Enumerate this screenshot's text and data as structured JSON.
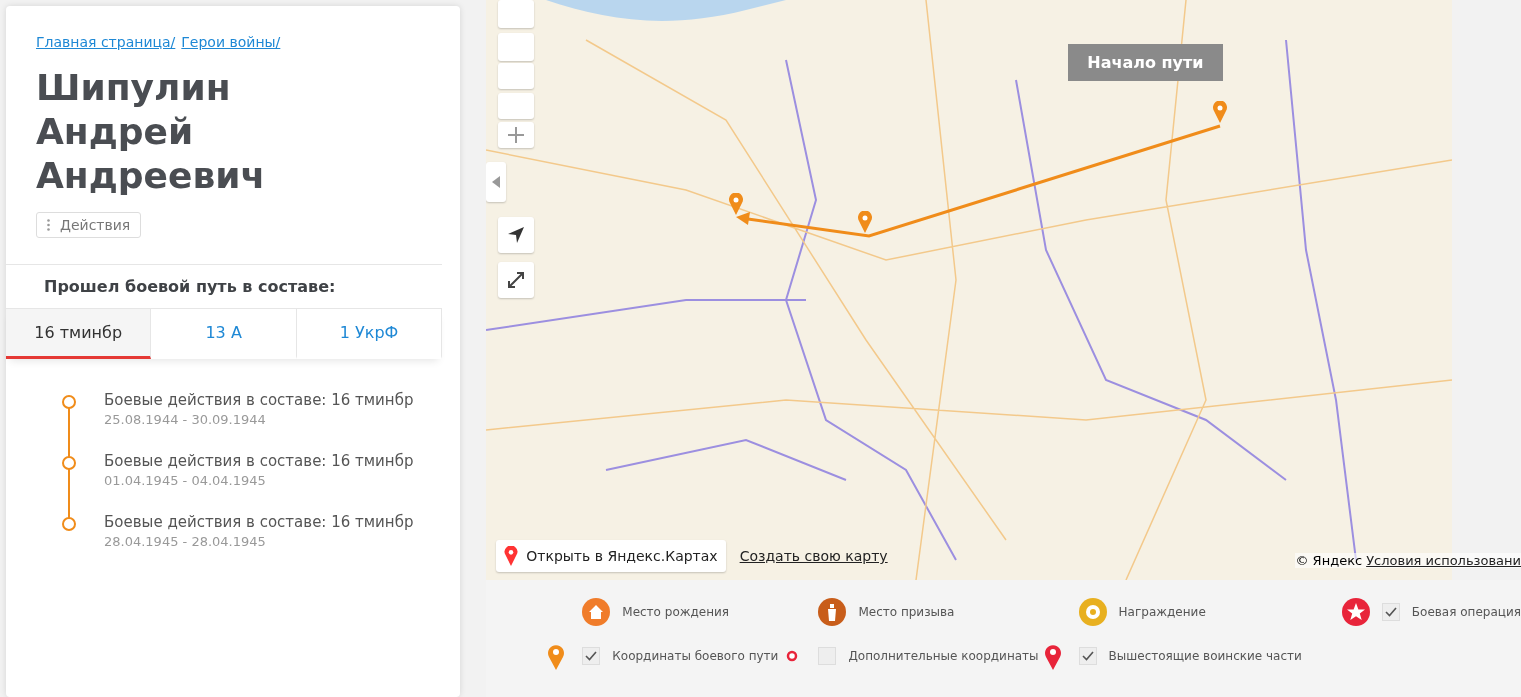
{
  "breadcrumbs": [
    "Главная страница/",
    "Герои войны/"
  ],
  "title": "Шипулин Андрей Андреевич",
  "actions_button": "Действия",
  "section_heading": "Прошел боевой путь в составе:",
  "tabs": [
    {
      "label": "16 тминбр",
      "selected": true
    },
    {
      "label": "13 А",
      "selected": false
    },
    {
      "label": "1 УкрФ",
      "selected": false
    }
  ],
  "timeline": [
    {
      "title": "Боевые действия в составе: 16 тминбр",
      "dates": "25.08.1944 - 30.09.1944"
    },
    {
      "title": "Боевые действия в составе: 16 тминбр",
      "dates": "01.04.1945 - 04.04.1945"
    },
    {
      "title": "Боевые действия в составе: 16 тминбр",
      "dates": "28.04.1945 - 28.04.1945"
    }
  ],
  "map": {
    "start_label": "Начало пути",
    "open_link": "Открыть в Яндекс.Картах",
    "create_link": "Создать свою карту",
    "copyright": "© Яндекс",
    "terms_link": "Условия использовани"
  },
  "legend": [
    {
      "kind": "house",
      "label": "Место рождения"
    },
    {
      "kind": "soldier",
      "label": "Место призыва"
    },
    {
      "kind": "medal",
      "label": "Награждение"
    },
    {
      "kind": "star",
      "label": "Боевая операция",
      "checked": true
    },
    {
      "kind": "pin",
      "label": "Координаты боевого пути",
      "checked": true
    },
    {
      "kind": "dot",
      "label": "Дополнительные координаты",
      "checked": false
    },
    {
      "kind": "redpin",
      "label": "Вышестоящие воинские части",
      "checked": true
    }
  ]
}
